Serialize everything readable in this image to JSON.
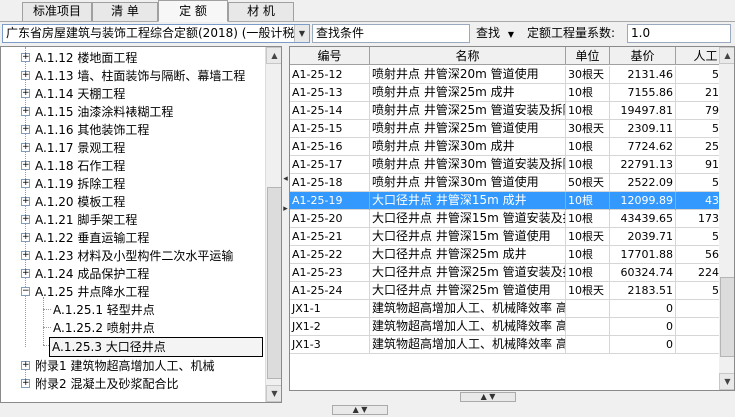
{
  "tabs": [
    {
      "label": "标准项目"
    },
    {
      "label": "清 单"
    },
    {
      "label": "定 额"
    },
    {
      "label": "材 机"
    }
  ],
  "toolbar": {
    "library_value": "广东省房屋建筑与装饰工程综合定额(2018) (一般计税)",
    "search_input": "查找条件",
    "search_button": "查找",
    "coef_label": "定额工程量系数:",
    "coef_value": "1.0"
  },
  "tree": [
    {
      "label": "A.1.12 楼地面工程"
    },
    {
      "label": "A.1.13 墙、柱面装饰与隔断、幕墙工程"
    },
    {
      "label": "A.1.14 天棚工程"
    },
    {
      "label": "A.1.15 油漆涂料裱糊工程"
    },
    {
      "label": "A.1.16 其他装饰工程"
    },
    {
      "label": "A.1.17 景观工程"
    },
    {
      "label": "A.1.18 石作工程"
    },
    {
      "label": "A.1.19 拆除工程"
    },
    {
      "label": "A.1.20 模板工程"
    },
    {
      "label": "A.1.21 脚手架工程"
    },
    {
      "label": "A.1.22 垂直运输工程"
    },
    {
      "label": "A.1.23 材料及小型构件二次水平运输"
    },
    {
      "label": "A.1.24 成品保护工程"
    },
    {
      "label": "A.1.25 井点降水工程"
    },
    {
      "label": "A.1.25.1 轻型井点"
    },
    {
      "label": "A.1.25.2 喷射井点"
    },
    {
      "label": "A.1.25.3 大口径井点"
    },
    {
      "label": "附录1 建筑物超高增加人工、机械"
    },
    {
      "label": "附录2 混凝土及砂浆配合比"
    }
  ],
  "grid": {
    "headers": [
      "编号",
      "名称",
      "单位",
      "基价",
      "人工"
    ],
    "rows": [
      [
        "A1-25-12",
        "喷射井点 井管深20m 管道使用",
        "30根天",
        "2131.46",
        "535"
      ],
      [
        "A1-25-13",
        "喷射井点 井管深25m 成井",
        "10根",
        "7155.86",
        "2186"
      ],
      [
        "A1-25-14",
        "喷射井点 井管深25m 管道安装及拆除",
        "10根",
        "19497.81",
        "7931"
      ],
      [
        "A1-25-15",
        "喷射井点 井管深25m 管道使用",
        "30根天",
        "2309.11",
        "535"
      ],
      [
        "A1-25-16",
        "喷射井点 井管深30m 成井",
        "10根",
        "7724.62",
        "2522"
      ],
      [
        "A1-25-17",
        "喷射井点 井管深30m 管道安装及拆除",
        "10根",
        "22791.13",
        "9144"
      ],
      [
        "A1-25-18",
        "喷射井点 井管深30m 管道使用",
        "50根天",
        "2522.09",
        "535"
      ],
      [
        "A1-25-19",
        "大口径井点 井管深15m 成井",
        "10根",
        "12099.89",
        "4364"
      ],
      [
        "A1-25-20",
        "大口径井点 井管深15m 管道安装及拆除",
        "10根",
        "43439.65",
        "17370"
      ],
      [
        "A1-25-21",
        "大口径井点 井管深15m 管道使用",
        "10根天",
        "2039.71",
        "535"
      ],
      [
        "A1-25-22",
        "大口径井点 井管深25m 成井",
        "10根",
        "17701.88",
        "5630"
      ],
      [
        "A1-25-23",
        "大口径井点 井管深25m 管道安装及拆除",
        "10根",
        "60324.74",
        "22408"
      ],
      [
        "A1-25-24",
        "大口径井点 井管深25m 管道使用",
        "10根天",
        "2183.51",
        "535"
      ],
      [
        "JX1-1",
        "建筑物超高增加人工、机械降效率 高度",
        "",
        "0",
        ""
      ],
      [
        "JX1-2",
        "建筑物超高增加人工、机械降效率 高度",
        "",
        "0",
        ""
      ],
      [
        "JX1-3",
        "建筑物超高增加人工、机械降效率 高度",
        "",
        "0",
        ""
      ]
    ]
  },
  "colors": {
    "selection": "#3399ff",
    "border": "#7a9cc6"
  }
}
